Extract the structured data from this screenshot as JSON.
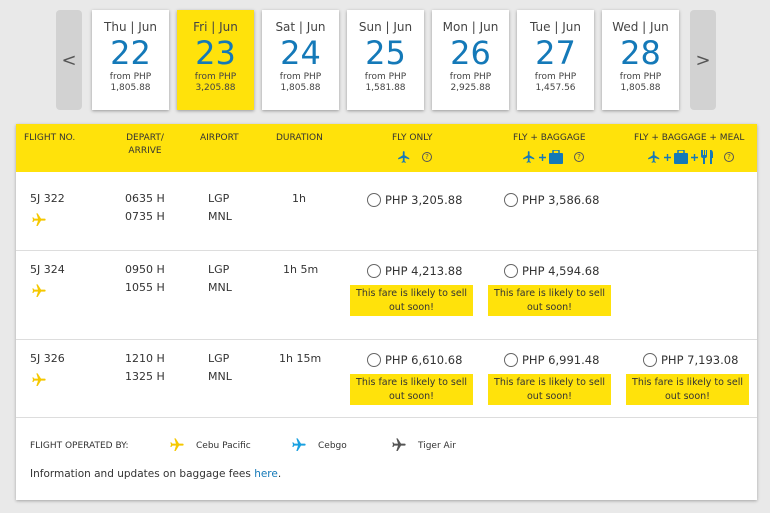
{
  "date_nav": {
    "prev_glyph": "<",
    "next_glyph": ">"
  },
  "days": [
    {
      "label": "Thu | Jun",
      "num": "22",
      "from": "from PHP",
      "price": "1,805.88",
      "selected": false
    },
    {
      "label": "Fri | Jun",
      "num": "23",
      "from": "from PHP",
      "price": "3,205.88",
      "selected": true
    },
    {
      "label": "Sat | Jun",
      "num": "24",
      "from": "from PHP",
      "price": "1,805.88",
      "selected": false
    },
    {
      "label": "Sun | Jun",
      "num": "25",
      "from": "from PHP",
      "price": "1,581.88",
      "selected": false
    },
    {
      "label": "Mon | Jun",
      "num": "26",
      "from": "from PHP",
      "price": "2,925.88",
      "selected": false
    },
    {
      "label": "Tue | Jun",
      "num": "27",
      "from": "from PHP",
      "price": "1,457.56",
      "selected": false
    },
    {
      "label": "Wed | Jun",
      "num": "28",
      "from": "from PHP",
      "price": "1,805.88",
      "selected": false
    }
  ],
  "table_header": {
    "flight_no": "FLIGHT NO.",
    "depart_line1": "DEPART/",
    "depart_line2": "ARRIVE",
    "airport": "AIRPORT",
    "duration": "DURATION",
    "fly_only": "FLY ONLY",
    "fly_baggage": "FLY + BAGGAGE",
    "fly_baggage_meal": "FLY + BAGGAGE + MEAL",
    "info_glyph": "?"
  },
  "flights": [
    {
      "flight_no": "5J 322",
      "depart": "0635 H",
      "arrive": "0735 H",
      "from": "LGP",
      "to": "MNL",
      "duration": "1h",
      "fly_only": "PHP 3,205.88",
      "fly_baggage": "PHP 3,586.68",
      "fly_baggage_meal": "",
      "sellout_fly_only": "",
      "sellout_fly_baggage": "",
      "sellout_fly_baggage_meal": ""
    },
    {
      "flight_no": "5J 324",
      "depart": "0950 H",
      "arrive": "1055 H",
      "from": "LGP",
      "to": "MNL",
      "duration": "1h 5m",
      "fly_only": "PHP 4,213.88",
      "fly_baggage": "PHP 4,594.68",
      "fly_baggage_meal": "",
      "sellout_fly_only": "This fare is likely to sell out soon!",
      "sellout_fly_baggage": "This fare is likely to sell out soon!",
      "sellout_fly_baggage_meal": ""
    },
    {
      "flight_no": "5J 326",
      "depart": "1210 H",
      "arrive": "1325 H",
      "from": "LGP",
      "to": "MNL",
      "duration": "1h 15m",
      "fly_only": "PHP 6,610.68",
      "fly_baggage": "PHP 6,991.48",
      "fly_baggage_meal": "PHP 7,193.08",
      "sellout_fly_only": "This fare is likely to sell out soon!",
      "sellout_fly_baggage": "This fare is likely to sell out soon!",
      "sellout_fly_baggage_meal": "This fare is likely to sell out soon!"
    }
  ],
  "footer": {
    "operated_by": "FLIGHT OPERATED BY:",
    "carriers": [
      {
        "name": "Cebu Pacific",
        "color": "#f5c800"
      },
      {
        "name": "Cebgo",
        "color": "#1aa0e0"
      },
      {
        "name": "Tiger Air",
        "color": "#555555"
      }
    ],
    "info_text": "Information and updates on baggage fees ",
    "info_link": "here",
    "info_end": "."
  },
  "colors": {
    "accent_yellow": "#ffe20b",
    "brand_blue": "#1479b8",
    "header_icon_blue": "#1479b8"
  }
}
